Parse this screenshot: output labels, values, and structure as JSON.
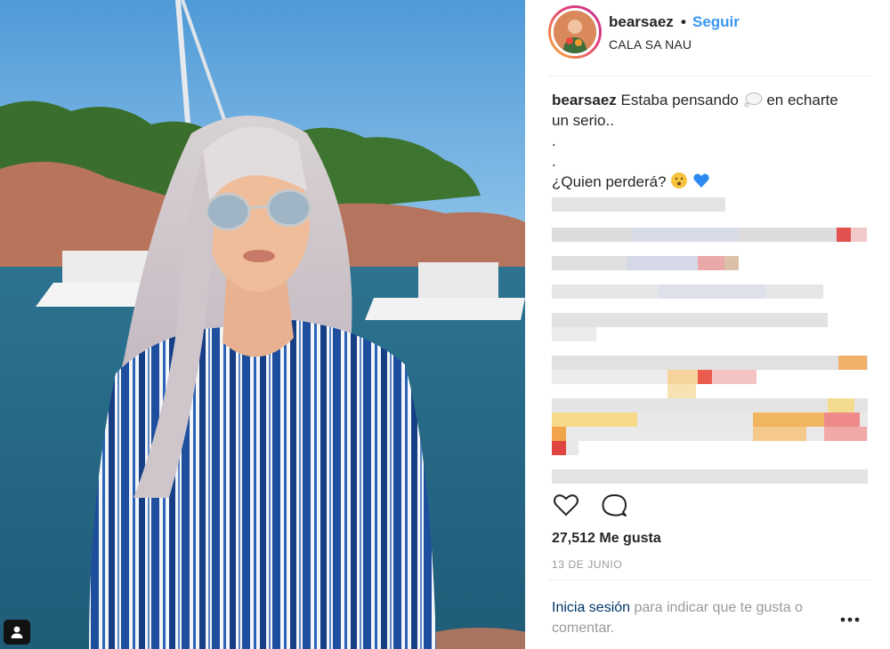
{
  "post": {
    "username": "bearsaez",
    "separator": "•",
    "follow_label": "Seguir",
    "location": "CALA SA NAU",
    "caption": {
      "user": "bearsaez",
      "line1": "Estaba pensando",
      "line1_after": "en echarte",
      "line2": "un serio..",
      "line3": ".",
      "line4": ".",
      "line5": "¿Quien perderá?"
    },
    "likes_text": "27,512 Me gusta",
    "date_text": "13 DE JUNIO",
    "login_prompt": {
      "link": "Inicia sesión",
      "rest": " para indicar que te gusta o comentar."
    }
  },
  "icons": {
    "tag": "user-tag-icon",
    "like": "heart-icon",
    "comment": "comment-icon",
    "more": "more-options-icon",
    "thought": "thought-bubble-emoji",
    "shush": "shushing-face-emoji",
    "heart": "blue-heart-emoji"
  },
  "colors": {
    "link_blue": "#3897f0",
    "text": "#262626",
    "muted": "#999999",
    "login_link": "#003569"
  }
}
